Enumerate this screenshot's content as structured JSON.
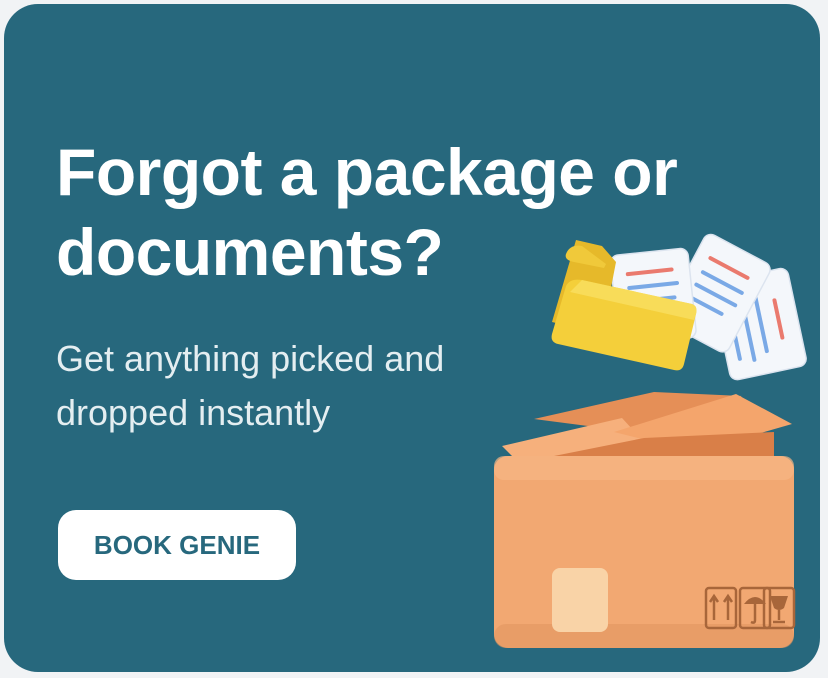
{
  "promo": {
    "headline": "Forgot a package or documents?",
    "subtext": "Get anything picked and dropped instantly",
    "cta_label": "BOOK GENIE"
  },
  "colors": {
    "card_background": "#27687d",
    "headline_text": "#ffffff",
    "cta_background": "#ffffff",
    "cta_text": "#27687d",
    "box": "#f2a872",
    "folder": "#f4cf3a",
    "document_lines_blue": "#7aa9e6",
    "document_lines_red": "#ea7a6e"
  },
  "icons": {
    "illustration": "package-box-with-documents",
    "box_labels": [
      "this-way-up-icon",
      "keep-dry-umbrella-icon",
      "fragile-glass-icon"
    ]
  }
}
